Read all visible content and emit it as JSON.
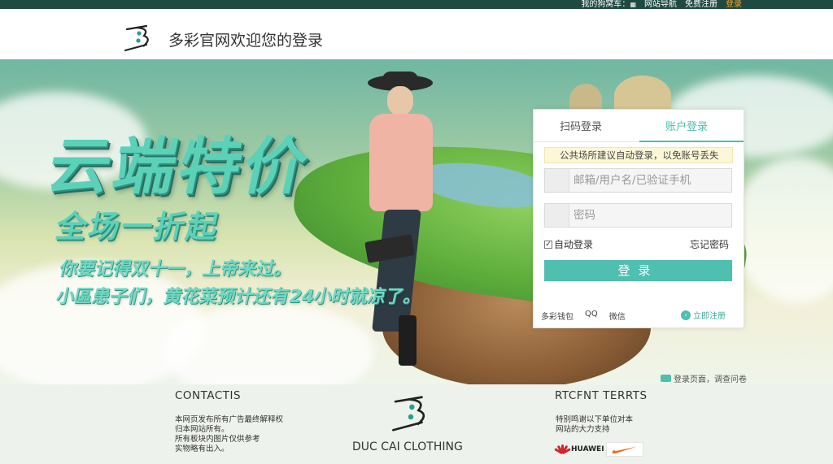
{
  "topbar": {
    "cart_label": "我的狗窝车：",
    "cart_icon": "calendar-icon",
    "nav_label": "网站导航",
    "register_label": "免费注册",
    "login_label": "登录",
    "accent_color": "#f5a623"
  },
  "header": {
    "title": "多彩官网欢迎您的登录",
    "logo_icon": "brand-logo-icon"
  },
  "banner": {
    "promo_title": "云端特价",
    "promo_subtitle": "全场一折起",
    "promo_line1": "你要记得双十一，上帝来过。",
    "promo_line2": "小區患子们，黄花菜预计还有24小时就凉了。"
  },
  "login": {
    "tab_qr": "扫码登录",
    "tab_account": "账户登录",
    "notice": "公共场所建议自动登录，以免账号丢失",
    "username_placeholder": "邮箱/用户名/已验证手机",
    "password_placeholder": "密码",
    "remember_label": "自动登录",
    "remember_checked": true,
    "forgot_label": "忘记密码",
    "submit_label": "登录",
    "alt_logins": [
      "多彩钱包",
      "QQ",
      "微信"
    ],
    "register_label": "立即注册",
    "accent_color": "#4fbfb0"
  },
  "feedback": {
    "label": "登录页面，调查问卷"
  },
  "footer": {
    "contact_heading": "CONTACTIS",
    "contact_lines": [
      "本网页发布所有广告最终解释权",
      "归本网站所有。",
      "所有板块内图片仅供参考",
      "实物略有出入。"
    ],
    "brand_name": "DUC CAI CLOTHING",
    "partners_heading": "RTCFNT  TERRTS",
    "partners_lines": [
      "特别鸣谢以下单位对本",
      "网站的大力支持"
    ],
    "sponsor_huawei": "HUAWEI",
    "sponsor_nike_icon": "nike-swoosh-icon"
  }
}
